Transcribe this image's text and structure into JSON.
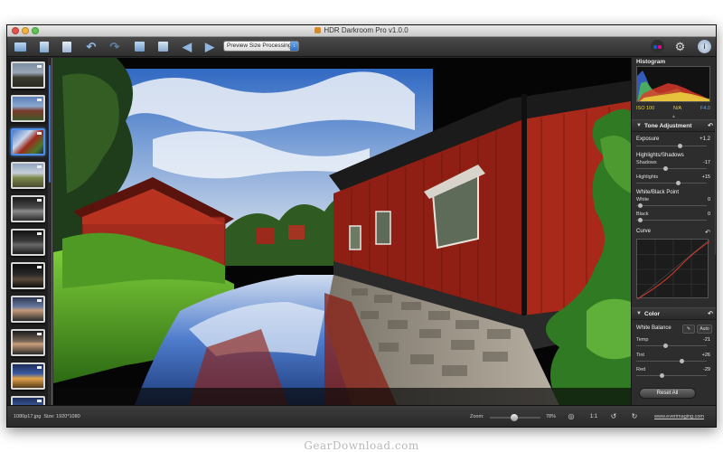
{
  "window": {
    "title": "HDR Darkroom Pro v1.0.0"
  },
  "toolbar": {
    "icons": [
      "open-folder-icon",
      "open-file-icon",
      "export-icon",
      "undo-icon",
      "redo-icon",
      "compare-icon",
      "crop-icon",
      "previous-arrow-icon",
      "next-arrow-icon"
    ],
    "processing_select": "Preview Size Processing",
    "right_icons": [
      "flickr-icon",
      "settings-gear-icon",
      "info-icon"
    ]
  },
  "filmstrip": {
    "count": 11,
    "selected_index": 2
  },
  "panel": {
    "histogram": {
      "title": "Histogram",
      "iso": "ISO 100",
      "shutter": "N/A",
      "aperture": "F4.0"
    },
    "tone": {
      "title": "Tone Adjustment",
      "exposure_label": "Exposure",
      "exposure_value": "+1.2",
      "highlights_shadows_label": "Highlights/Shadows",
      "shadows_label": "Shadows",
      "shadows_value": "-17",
      "highlights_label": "Highlights",
      "highlights_value": "+15",
      "white_black_label": "White/Black Point",
      "white_label": "White",
      "white_value": "0",
      "black_label": "Black",
      "black_value": "0"
    },
    "curve": {
      "title": "Curve"
    },
    "color": {
      "title": "Color",
      "white_balance_label": "White Balance",
      "auto_label": "Auto",
      "temp_label": "Temp",
      "temp_value": "-21",
      "tint_label": "Tint",
      "tint_value": "+26",
      "red_label": "Red",
      "red_value": "-29"
    },
    "reset_all": "Reset All"
  },
  "status": {
    "file_name": "1080p17.jpg",
    "file_size": "Size: 1920*1080",
    "zoom_label": "Zoom:",
    "zoom_value": "78%",
    "zoom_level": 0.48,
    "actual_size": "1:1",
    "website": "www.everimaging.com"
  },
  "watermark": "GearDownload.com"
}
